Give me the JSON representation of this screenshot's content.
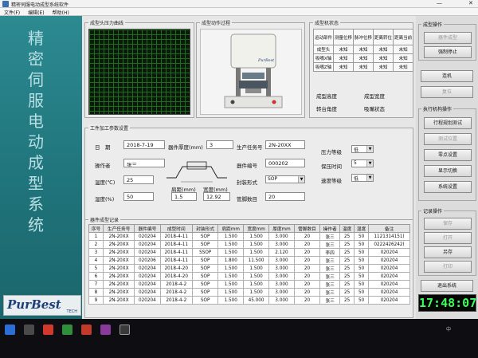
{
  "window": {
    "title": "精密伺服电动成型系统软件",
    "minimize": "—",
    "close": "✕"
  },
  "menu": [
    "文件(F)",
    "编辑(E)",
    "帮助(H)"
  ],
  "sidebar": {
    "title_chars": [
      "精",
      "密",
      "伺",
      "服",
      "电",
      "动",
      "成",
      "型",
      "系",
      "统"
    ],
    "logo": "PurBest",
    "logo_sub": "TECH"
  },
  "curve_panel": {
    "title": "成型头压力曲线"
  },
  "motion_panel": {
    "title": "成型动作过程",
    "machine_brand": "PurBest"
  },
  "status_panel": {
    "title": "成型机状态",
    "headers": [
      "运动部件",
      "测量位移",
      "脉冲位移",
      "距离转位",
      "距离当前"
    ],
    "rows": [
      [
        "成型头",
        "未知",
        "未知",
        "未知",
        "未知"
      ],
      [
        "吸嘴X轴",
        "未知",
        "未知",
        "未知",
        "未知"
      ],
      [
        "吸嘴Z轴",
        "未知",
        "未知",
        "未知",
        "未知"
      ]
    ],
    "height_label": "成型高度",
    "width_label": "成型宽度",
    "angle_label": "转台角度",
    "suction_label": "吸嘴状态"
  },
  "params": {
    "title": "工件加工参数设置",
    "date_label": "日　期",
    "date_value": "2018-7-19",
    "thickness_label": "器件厚度(mm)",
    "thickness_value": "3",
    "task_label": "生产任务号",
    "task_value": "2N-20XX",
    "operator_label": "操作者",
    "operator_value": "张三",
    "device_no_label": "器件编号",
    "device_no_value": "000202",
    "temp_label": "温度(℃)",
    "temp_value": "25",
    "package_label": "封装形式",
    "package_value": "SOP",
    "humidity_label": "湿度(%)",
    "humidity_value": "50",
    "span_label": "肩距(mm)",
    "span_value": "1.5",
    "width_label": "宽度(mm)",
    "width_value": "12.92",
    "pin_count_label": "管脚数目",
    "pin_count_value": "20",
    "pressure_label": "压力等级",
    "pressure_value": "低",
    "hold_label": "保压时间",
    "hold_value": "5",
    "speed_label": "速度等级",
    "speed_value": "低"
  },
  "records": {
    "title": "器件成型记录",
    "headers": [
      "序号",
      "生产任务号",
      "器件编号",
      "成型时间",
      "封装形式",
      "肩距mm",
      "宽度mm",
      "厚度mm",
      "管脚数目",
      "操作者",
      "温度",
      "湿度",
      "备注"
    ],
    "rows": [
      [
        "1",
        "2N-20XX",
        "020204",
        "2018-4-11",
        "SOP",
        "1.500",
        "1.500",
        "3.000",
        "20",
        "张三",
        "25",
        "50",
        "1121314151("
      ],
      [
        "2",
        "2N-20XX",
        "020204",
        "2018-4-11",
        "SOP",
        "1.500",
        "1.500",
        "3.000",
        "20",
        "张三",
        "25",
        "50",
        "0222426242("
      ],
      [
        "3",
        "2N-20XX",
        "020204",
        "2018-4-11",
        "SSOP",
        "1.500",
        "1.500",
        "2.120",
        "20",
        "李四",
        "25",
        "50",
        "020204"
      ],
      [
        "4",
        "2N-20XX",
        "020206",
        "2018-4-11",
        "SOP",
        "1.800",
        "11.500",
        "3.000",
        "20",
        "张三",
        "25",
        "50",
        "020204"
      ],
      [
        "5",
        "2N-20XX",
        "020204",
        "2018-4-20",
        "SOP",
        "1.500",
        "1.500",
        "3.000",
        "20",
        "张三",
        "25",
        "50",
        "020204"
      ],
      [
        "6",
        "2N-20XX",
        "020204",
        "2018-4-20",
        "SOP",
        "1.500",
        "1.500",
        "3.000",
        "20",
        "张三",
        "25",
        "50",
        "020204"
      ],
      [
        "7",
        "2N-20XX",
        "020204",
        "2018-4-2",
        "SOP",
        "1.500",
        "1.500",
        "3.000",
        "20",
        "张三",
        "25",
        "50",
        "020204"
      ],
      [
        "8",
        "2N-20XX",
        "020204",
        "2018-4-2",
        "SOP",
        "1.500",
        "1.500",
        "3.000",
        "20",
        "张三",
        "25",
        "50",
        "020204"
      ],
      [
        "9",
        "2N-20XX",
        "020204",
        "2018-4-2",
        "SOP",
        "1.500",
        "45.000",
        "3.000",
        "20",
        "张三",
        "25",
        "50",
        "020204"
      ]
    ]
  },
  "right_panel": {
    "ops_title": "成型操作",
    "ops_buttons": [
      "器件成型",
      "强制停止"
    ],
    "connect_button": "连机",
    "reset_button": "复位",
    "exec_title": "执行机构操作",
    "exec_buttons": [
      "行程规划测试",
      "测试位置",
      "零点设置",
      "显示切换",
      "系统设置"
    ],
    "record_title": "记录操作",
    "record_buttons": [
      "保存",
      "打开",
      "另存",
      "打印"
    ],
    "exit_button": "退出系统",
    "clock": "17:48:07"
  },
  "taskbar": {
    "tray_text": "中"
  },
  "colors": {
    "sidebar": "#1f7279",
    "plot_bg": "#0b1a0b",
    "clock_digits": "#3cff5c",
    "logo": "#1c3f7a"
  }
}
